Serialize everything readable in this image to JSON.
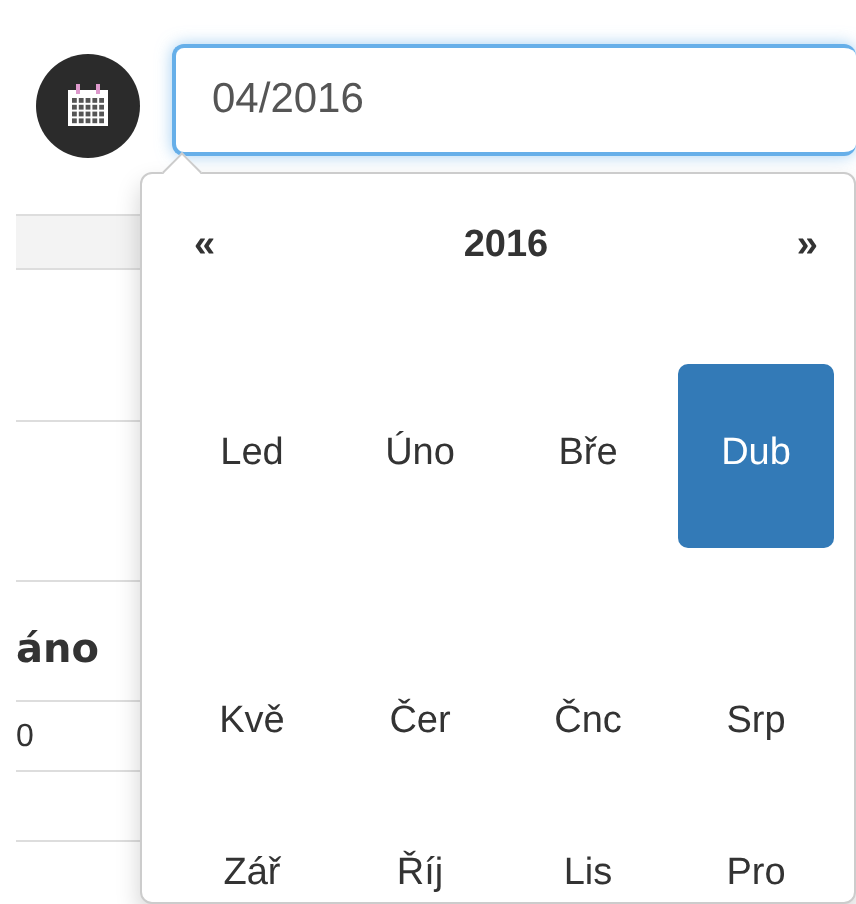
{
  "date_field": {
    "value": "04/2016"
  },
  "background_table": {
    "header": "áno",
    "cell": "0"
  },
  "picker": {
    "prev": "«",
    "year": "2016",
    "next": "»",
    "months": [
      {
        "label": "Led",
        "selected": false
      },
      {
        "label": "Úno",
        "selected": false
      },
      {
        "label": "Bře",
        "selected": false
      },
      {
        "label": "Dub",
        "selected": true
      },
      {
        "label": "Kvě",
        "selected": false
      },
      {
        "label": "Čer",
        "selected": false
      },
      {
        "label": "Čnc",
        "selected": false
      },
      {
        "label": "Srp",
        "selected": false
      },
      {
        "label": "Zář",
        "selected": false
      },
      {
        "label": "Říj",
        "selected": false
      },
      {
        "label": "Lis",
        "selected": false
      },
      {
        "label": "Pro",
        "selected": false
      }
    ]
  }
}
